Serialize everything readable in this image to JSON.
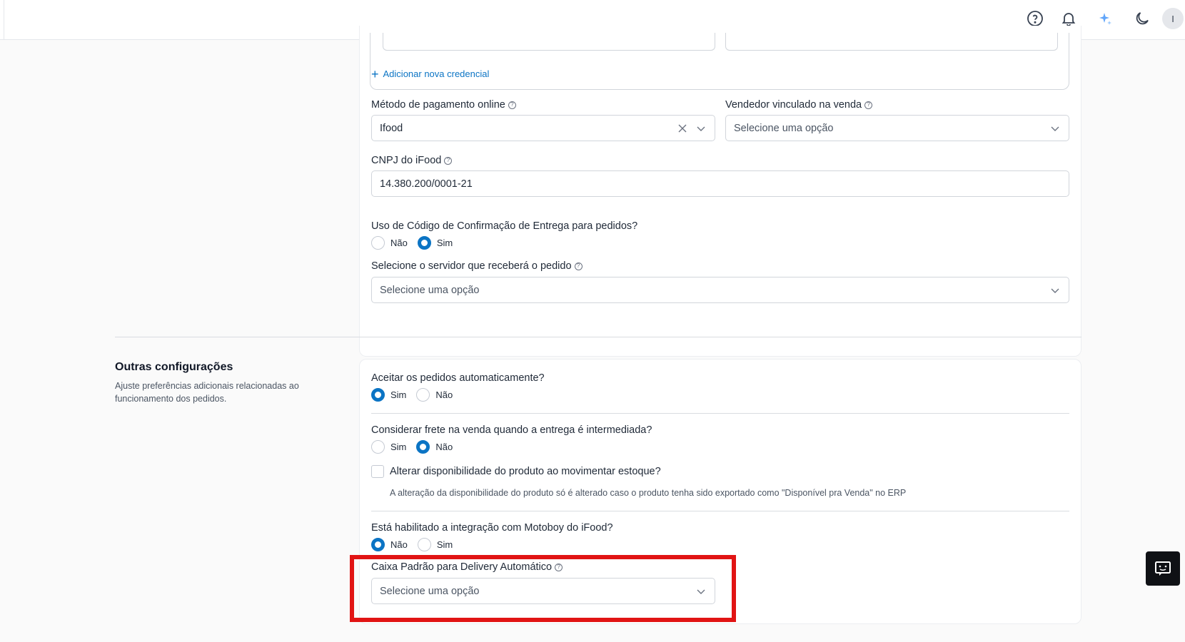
{
  "topbar": {
    "icons": [
      "help-circle-icon",
      "bell-icon",
      "sparkle-icon",
      "moon-icon"
    ],
    "avatar_initial": "I"
  },
  "credentials": {
    "add_link": "Adicionar nova credencial"
  },
  "payment": {
    "label": "Método de pagamento online",
    "value": "Ifood"
  },
  "seller": {
    "label": "Vendedor vinculado na venda",
    "placeholder": "Selecione uma opção"
  },
  "cnpj": {
    "label": "CNPJ do iFood",
    "value": "14.380.200/0001-21"
  },
  "confirmation_code": {
    "label": "Uso de Código de Confirmação de Entrega para pedidos?",
    "options": [
      "Não",
      "Sim"
    ],
    "selected": "Sim"
  },
  "server": {
    "label": "Selecione o servidor que receberá o pedido",
    "placeholder": "Selecione uma opção"
  },
  "other": {
    "title": "Outras configurações",
    "description": "Ajuste preferências adicionais relacionadas ao funcionamento dos pedidos.",
    "auto_accept": {
      "label": "Aceitar os pedidos automaticamente?",
      "options": [
        "Sim",
        "Não"
      ],
      "selected": "Sim"
    },
    "freight": {
      "label": "Considerar frete na venda quando a entrega é intermediada?",
      "options": [
        "Sim",
        "Não"
      ],
      "selected": "Não"
    },
    "availability": {
      "label": "Alterar disponibilidade do produto ao movimentar estoque?",
      "checked": false,
      "hint": "A alteração da disponibilidade do produto só é alterado caso o produto tenha sido exportado como \"Disponível pra Venda\" no ERP"
    },
    "motoboy": {
      "label": "Está habilitado a integração com Motoboy do iFood?",
      "options": [
        "Não",
        "Sim"
      ],
      "selected": "Não"
    },
    "default_cashier": {
      "label": "Caixa Padrão para Delivery Automático",
      "placeholder": "Selecione uma opção"
    }
  },
  "colors": {
    "accent": "#0b74c4",
    "highlight": "#e11414"
  }
}
